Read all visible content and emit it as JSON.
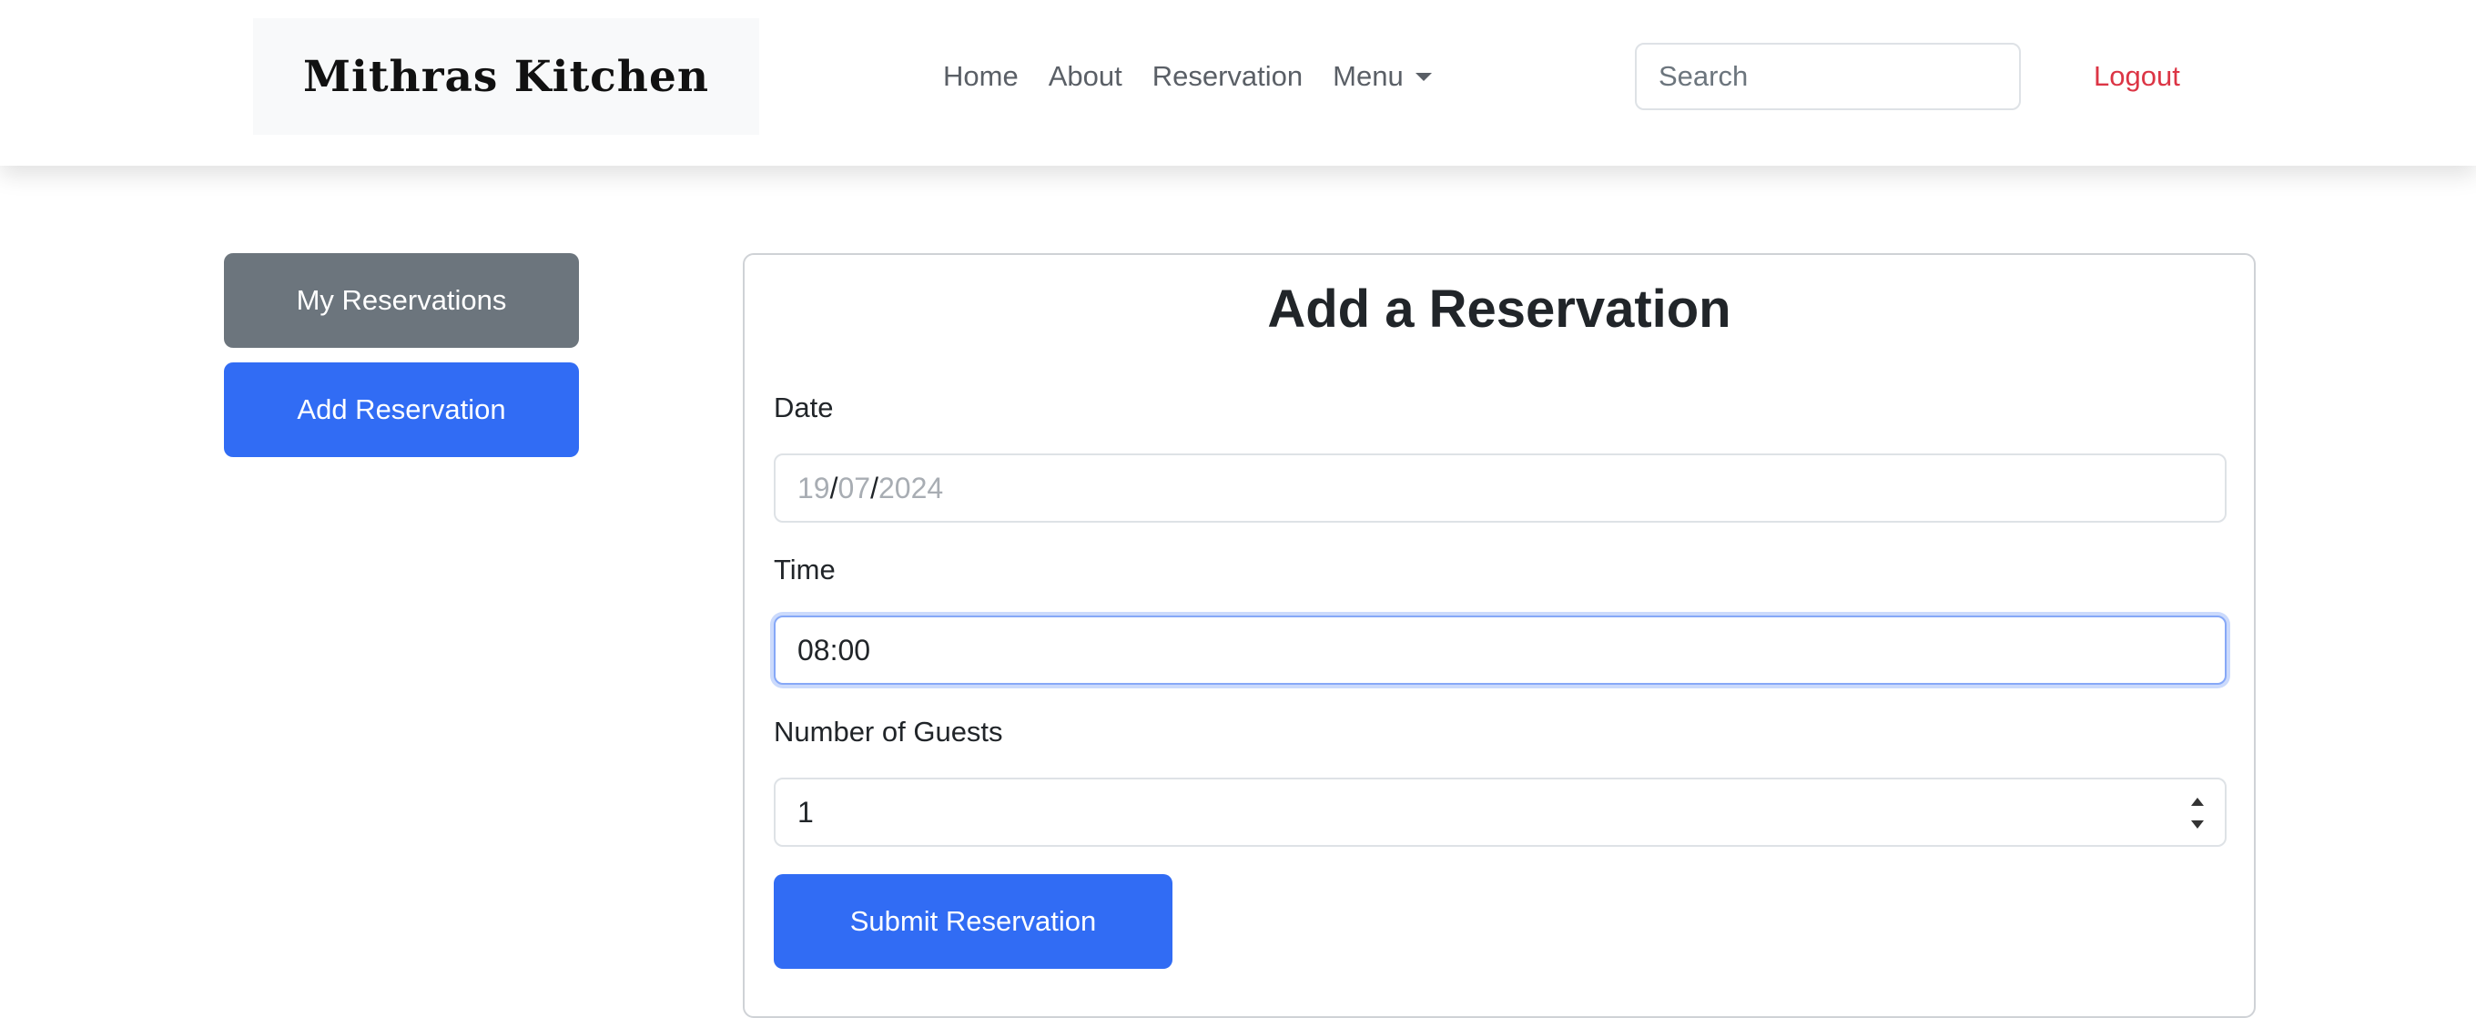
{
  "header": {
    "brand": "Mithras Kitchen",
    "nav": {
      "home": "Home",
      "about": "About",
      "reservation": "Reservation",
      "menu": "Menu"
    },
    "search": {
      "placeholder": "Search",
      "value": ""
    },
    "logout": "Logout"
  },
  "sidebar": {
    "my_reservations": "My Reservations",
    "add_reservation": "Add Reservation"
  },
  "form": {
    "title": "Add a Reservation",
    "date": {
      "label": "Date",
      "day": "19",
      "month": "07",
      "year": "2024",
      "separator": "/"
    },
    "time": {
      "label": "Time",
      "value": "08:00"
    },
    "guests": {
      "label": "Number of Guests",
      "value": "1"
    },
    "submit": "Submit Reservation"
  },
  "colors": {
    "primary": "#316cf4",
    "secondary": "#6c757d",
    "danger": "#dc3545"
  },
  "icons": {
    "menu_caret": "caret-down-icon",
    "guests_spinner": "spinner-icon"
  }
}
